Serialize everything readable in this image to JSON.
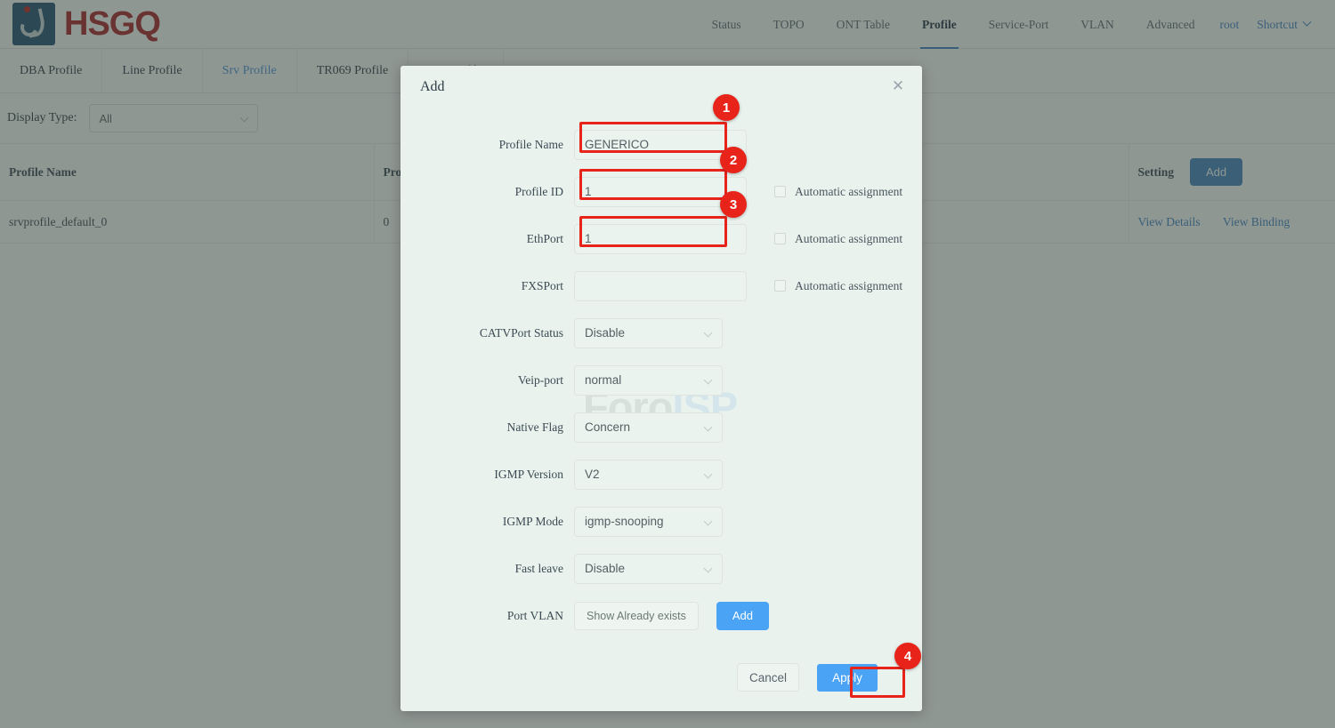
{
  "brand": {
    "name": "HSGQ",
    "logo_icon": "hsgq-droplet-logo"
  },
  "topnav": {
    "items": [
      {
        "label": "Status",
        "active": false
      },
      {
        "label": "TOPO",
        "active": false
      },
      {
        "label": "ONT Table",
        "active": false
      },
      {
        "label": "Profile",
        "active": true
      },
      {
        "label": "Service-Port",
        "active": false
      },
      {
        "label": "VLAN",
        "active": false
      },
      {
        "label": "Advanced",
        "active": false
      }
    ],
    "user": "root",
    "shortcut": "Shortcut",
    "shortcut_icon": "chevron-down-icon"
  },
  "tabs": [
    {
      "label": "DBA Profile",
      "active": false
    },
    {
      "label": "Line Profile",
      "active": false
    },
    {
      "label": "Srv Profile",
      "active": true
    },
    {
      "label": "TR069 Profile",
      "active": false
    },
    {
      "label": "SIP Profile",
      "active": false
    }
  ],
  "filter": {
    "label": "Display Type:",
    "value": "All",
    "caret_icon": "chevron-down-icon"
  },
  "table": {
    "headers": {
      "profile_name": "Profile Name",
      "profile_id": "Prof",
      "setting": "Setting"
    },
    "header_add_button": "Add",
    "rows": [
      {
        "profile_name": "srvprofile_default_0",
        "profile_id": "0",
        "view_details": "View Details",
        "view_binding": "View Binding"
      }
    ]
  },
  "modal": {
    "title": "Add",
    "close_icon": "close-icon",
    "fields": {
      "profile_name": {
        "label": "Profile Name",
        "value": "GENERICO"
      },
      "profile_id": {
        "label": "Profile ID",
        "value": "1",
        "auto": "Automatic assignment",
        "checked": false
      },
      "ethport": {
        "label": "EthPort",
        "value": "1",
        "auto": "Automatic assignment",
        "checked": false
      },
      "fxsport": {
        "label": "FXSPort",
        "value": "",
        "auto": "Automatic assignment",
        "checked": false
      },
      "catvport_status": {
        "label": "CATVPort Status",
        "value": "Disable"
      },
      "veip_port": {
        "label": "Veip-port",
        "value": "normal"
      },
      "native_flag": {
        "label": "Native Flag",
        "value": "Concern"
      },
      "igmp_version": {
        "label": "IGMP Version",
        "value": "V2"
      },
      "igmp_mode": {
        "label": "IGMP Mode",
        "value": "igmp-snooping"
      },
      "fast_leave": {
        "label": "Fast leave",
        "value": "Disable"
      },
      "port_vlan": {
        "label": "Port VLAN",
        "show_button": "Show Already exists",
        "add_button": "Add"
      }
    },
    "footer": {
      "cancel": "Cancel",
      "apply": "Apply"
    }
  },
  "watermark": {
    "part1": "Foro",
    "part2": "ISP"
  },
  "annotations": {
    "badges": [
      {
        "number": "1",
        "target": "profile-name-input"
      },
      {
        "number": "2",
        "target": "profile-id-input"
      },
      {
        "number": "3",
        "target": "ethport-input"
      },
      {
        "number": "4",
        "target": "apply-button"
      }
    ],
    "color": "#e8241a"
  }
}
